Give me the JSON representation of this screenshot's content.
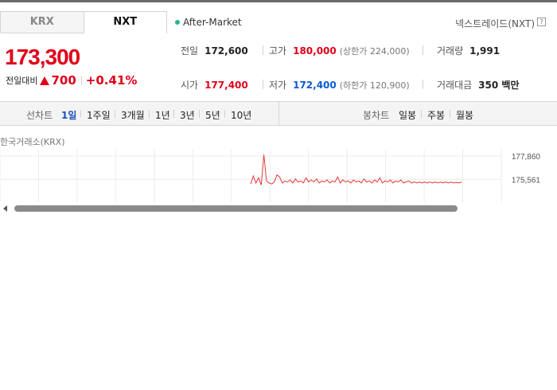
{
  "tabs": [
    {
      "label": "KRX",
      "active": false
    },
    {
      "label": "NXT",
      "active": true
    }
  ],
  "session": {
    "label": "After-Market",
    "dot_color": "#27b496"
  },
  "market_name": "넥스트레이드(NXT)",
  "help_icon": "?",
  "price": {
    "current": "173,300",
    "change_label": "전일대비",
    "change_amount": "700",
    "change_percent": "+0.41%",
    "direction": "up",
    "color": "#e0001a"
  },
  "stats": {
    "prev_close": {
      "label": "전일",
      "value": "172,600"
    },
    "high": {
      "label": "고가",
      "value": "180,000",
      "sub": "(상한가 224,000)"
    },
    "volume": {
      "label": "거래량",
      "value": "1,991"
    },
    "open": {
      "label": "시가",
      "value": "177,400"
    },
    "low": {
      "label": "저가",
      "value": "172,400",
      "sub": "(하한가 120,900)"
    },
    "amount": {
      "label": "거래대금",
      "value": "350 백만"
    }
  },
  "toolbar": {
    "line_chart_label": "선차트",
    "line_periods": [
      "1일",
      "1주일",
      "3개월",
      "1년",
      "3년",
      "5년",
      "10년"
    ],
    "active_period": "1일",
    "candle_chart_label": "봉차트",
    "candle_periods": [
      "일봉",
      "주봉",
      "월봉"
    ]
  },
  "chart_data": {
    "type": "line",
    "title": "한국거래소(KRX)",
    "y_ticks": [
      "177,860",
      "175,561"
    ],
    "ylim": [
      173300,
      178500
    ],
    "x": [
      0,
      1,
      2,
      3,
      4,
      5,
      6,
      7,
      8,
      9,
      10,
      11,
      12,
      13,
      14,
      15,
      16,
      17,
      18,
      19,
      20,
      21,
      22,
      23,
      24,
      25,
      26,
      27,
      28,
      29,
      30,
      31,
      32,
      33,
      34,
      35,
      36,
      37,
      38,
      39,
      40,
      41,
      42,
      43,
      44,
      45,
      46,
      47,
      48,
      49,
      50,
      51,
      52,
      53,
      54,
      55,
      56,
      57,
      58,
      59,
      60,
      61,
      62,
      63,
      64,
      65,
      66,
      67,
      68,
      69,
      70,
      71,
      72,
      73,
      74,
      75,
      76,
      77,
      78,
      79,
      80
    ],
    "series": [
      {
        "color": "#e8373a",
        "values": [
          175100,
          175900,
          175200,
          175700,
          175000,
          178000,
          175400,
          175200,
          175100,
          175300,
          176000,
          175800,
          175200,
          175400,
          175300,
          175500,
          175200,
          175600,
          175300,
          175400,
          175200,
          175700,
          175300,
          175500,
          175300,
          175600,
          175200,
          175400,
          175300,
          175500,
          175200,
          175400,
          175300,
          175800,
          175200,
          175500,
          175300,
          175400,
          175200,
          175500,
          175300,
          175400,
          175200,
          175600,
          175300,
          175400,
          175200,
          175500,
          175300,
          175700,
          175200,
          175400,
          175300,
          175500,
          175200,
          175400,
          175300,
          175500,
          175200,
          175300,
          175400,
          175200,
          175300,
          175200,
          175300,
          175200,
          175300,
          175200,
          175300,
          175200,
          175300,
          175200,
          175300,
          175200,
          175300,
          175200,
          175300,
          175200,
          175250,
          175200,
          175300
        ]
      }
    ],
    "grid": true
  }
}
